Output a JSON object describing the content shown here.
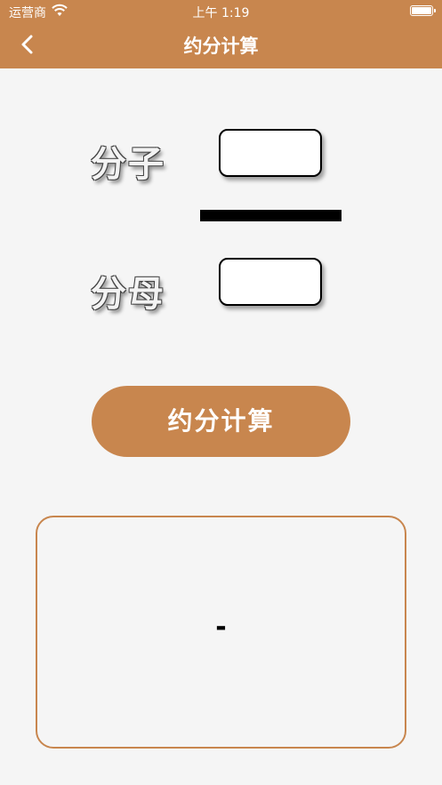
{
  "status_bar": {
    "carrier": "运营商",
    "time": "上午 1:19"
  },
  "nav": {
    "title": "约分计算",
    "back_icon": "chevron-left-icon"
  },
  "form": {
    "numerator_label": "分子",
    "numerator_value": "",
    "denominator_label": "分母",
    "denominator_value": ""
  },
  "button": {
    "label": "约分计算"
  },
  "result": {
    "text": "-"
  },
  "colors": {
    "accent": "#c8864e",
    "background": "#f5f5f5"
  }
}
